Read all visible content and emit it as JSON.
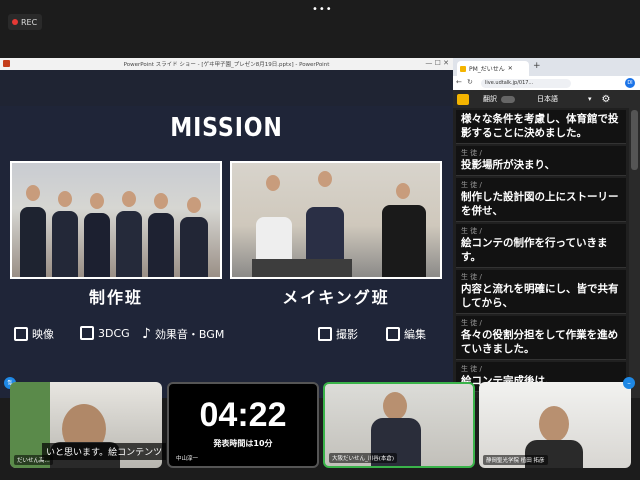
{
  "recording": {
    "label": "REC"
  },
  "window_menu": {
    "dots": "•••"
  },
  "powerpoint": {
    "title": "PowerPoint スライド ショー - [ゲヰ甲子園_プレゼン8月19日.pptx] - PowerPoint",
    "controls": "—  ☐  ✕",
    "slide": {
      "heading": "MISSION",
      "team_left": "制作班",
      "team_right": "メイキング班",
      "items_left": [
        "映像",
        "3DCG",
        "効果音・BGM"
      ],
      "items_right": [
        "撮影",
        "編集"
      ]
    }
  },
  "browser": {
    "tab_title": "PM_だいせん",
    "url": "live.udtalk.jp/017...",
    "translate_label": "翻訳",
    "language": "日本語",
    "avatar": "DI"
  },
  "chat": {
    "messages": [
      {
        "who": "",
        "text": "様々な条件を考慮し、体育館で投影することに決めました。"
      },
      {
        "who": "生 徒 /",
        "text": "投影場所が決まり、"
      },
      {
        "who": "生 徒 /",
        "text": "制作した設計図の上にストーリーを併せ、"
      },
      {
        "who": "生 徒 /",
        "text": "絵コンテの制作を行っていきます。"
      },
      {
        "who": "生 徒 /",
        "text": "内容と流れを明確にし、皆で共有してから、"
      },
      {
        "who": "生 徒 /",
        "text": "各々の役割分担をして作業を進めていきました。"
      },
      {
        "who": "生 徒 /",
        "text": "絵コンテ完成後は、"
      }
    ]
  },
  "participants": {
    "p1_name": "だいせん高...",
    "p1_caption": "いと思います。絵コンテンツ",
    "timer": "04:22",
    "timer_caption": "発表時間は10分",
    "p2_name": "中山淳一",
    "p3_name": "大阪だいせん_川谷(本倉)",
    "p4_name": "静岡聖光学院 植田 拓彦"
  }
}
